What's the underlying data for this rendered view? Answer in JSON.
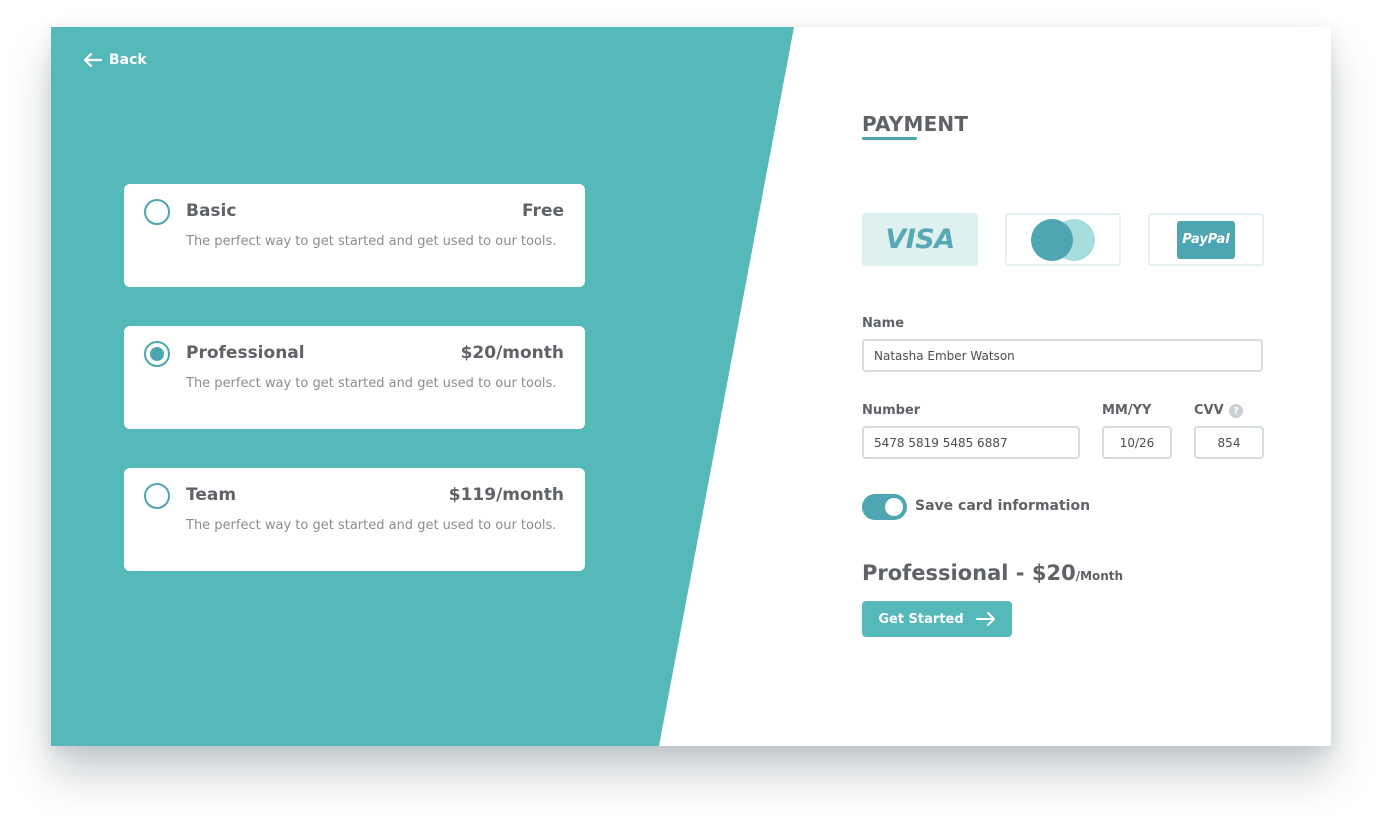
{
  "nav": {
    "back_label": "Back"
  },
  "plans": [
    {
      "name": "Basic",
      "price": "Free",
      "description": "The perfect way to get started and get used to our tools.",
      "selected": false
    },
    {
      "name": "Professional",
      "price": "$20/month",
      "description": "The perfect way to get started and get used to our tools.",
      "selected": true
    },
    {
      "name": "Team",
      "price": "$119/month",
      "description": "The perfect way to get started and get used to our tools.",
      "selected": false
    }
  ],
  "payment": {
    "title": "PAYMENT",
    "methods": [
      {
        "label": "VISA",
        "icon": "visa-logo-icon",
        "selected": true
      },
      {
        "label": "",
        "icon": "mastercard-logo-icon",
        "selected": false
      },
      {
        "label": "PayPal",
        "icon": "paypal-logo-icon",
        "selected": false
      }
    ],
    "name_label": "Name",
    "name_value": "Natasha Ember Watson",
    "number_label": "Number",
    "number_value": "5478 5819 5485 6887",
    "expiry_label": "MM/YY",
    "expiry_value": "10/26",
    "cvv_label": "CVV",
    "cvv_help": "?",
    "cvv_value": "854",
    "save_card_label": "Save card information",
    "save_card_on": true
  },
  "summary": {
    "plan": "Professional",
    "separator": " - ",
    "price": "$20",
    "period": "/Month"
  },
  "cta": {
    "label": "Get Started"
  },
  "colors": {
    "teal": "#55b9b9",
    "accent": "#4ea6b3",
    "text": "#5f6266",
    "muted": "#8a8d91"
  }
}
